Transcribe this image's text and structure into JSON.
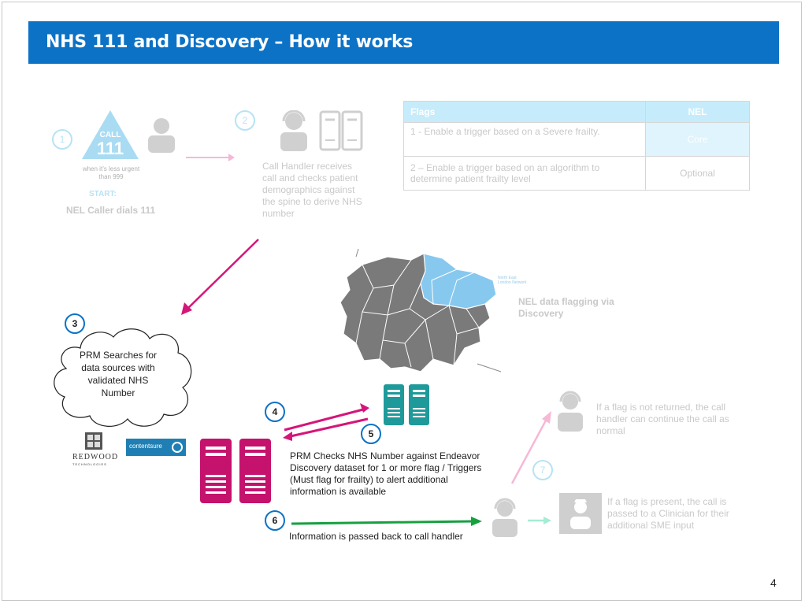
{
  "header": {
    "title": "NHS 111 and Discovery – How it works"
  },
  "steps": {
    "s1": {
      "num": "1",
      "start_label": "START:",
      "caption": "NEL Caller dials 111",
      "icon_top": "CALL",
      "icon_num": "111",
      "icon_sub": "when it’s less urgent than 999"
    },
    "s2": {
      "num": "2",
      "caption": "Call Handler receives call and checks patient demographics against the spine to derive NHS number"
    },
    "s3": {
      "num": "3",
      "caption": "PRM Searches for data sources with validated NHS Number"
    },
    "s4": {
      "num": "4"
    },
    "s5": {
      "num": "5",
      "caption": "PRM Checks NHS Number against Endeavor Discovery dataset for 1 or more flag / Triggers (Must flag for frailty) to alert additional information is available"
    },
    "s6": {
      "num": "6",
      "caption": "Information is passed back to call handler"
    },
    "s7": {
      "num": "7",
      "caption_not_returned": "If a flag is not returned, the call handler can continue the call as normal",
      "caption_present": "If a flag is present, the call is passed to a Clinician for their additional SME input"
    }
  },
  "flags_table": {
    "headers": [
      "Flags",
      "NEL"
    ],
    "rows": [
      {
        "flag": "1 - Enable a trigger based on a Severe frailty.",
        "nel": "Core"
      },
      {
        "flag": "2 – Enable a trigger based on an algorithm to determine patient frailty level",
        "nel": "Optional"
      }
    ]
  },
  "map": {
    "caption": "NEL data flagging via Discovery",
    "region_label": "North East London Network"
  },
  "logos": {
    "redwood": "REDWOOD",
    "redwood_sub": "TECHNOLOGIES",
    "contentsure": "contentsure"
  },
  "page_number": "4",
  "colors": {
    "title_bar": "#0c72c6",
    "magenta": "#d6157a",
    "teal": "#1f9a9a",
    "green": "#16a040",
    "faded_blue": "#b7e3f5",
    "map_grey": "#7a7a7a",
    "map_blue": "#87c8ef"
  }
}
